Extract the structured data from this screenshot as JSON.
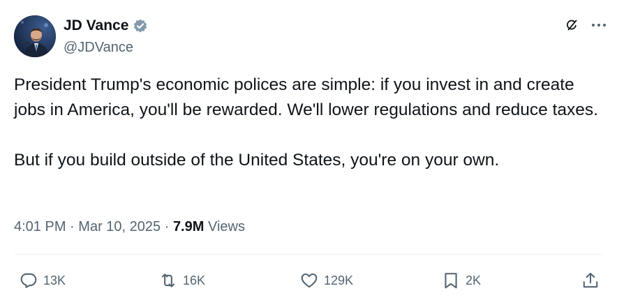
{
  "author": {
    "display_name": "JD Vance",
    "handle": "@JDVance",
    "verified": true,
    "verified_color": "#829aab"
  },
  "tweet": {
    "paragraphs": [
      "President Trump's economic polices are simple: if you invest in and create jobs in America, you'll be rewarded. We'll lower regulations and reduce taxes.",
      "But if you build outside of the United States, you're on your own."
    ]
  },
  "meta": {
    "time": "4:01 PM",
    "date": "Mar 10, 2025",
    "separator": "·",
    "views_count": "7.9M",
    "views_label": "Views"
  },
  "actions": {
    "reply_count": "13K",
    "repost_count": "16K",
    "like_count": "129K",
    "bookmark_count": "2K"
  },
  "icons": {
    "top": [
      "grok-icon",
      "more-icon"
    ],
    "actions": [
      "reply-icon",
      "repost-icon",
      "like-icon",
      "bookmark-icon",
      "share-icon"
    ]
  },
  "colors": {
    "text": "#0f1419",
    "secondary": "#536471",
    "divider": "#eff3f4"
  }
}
